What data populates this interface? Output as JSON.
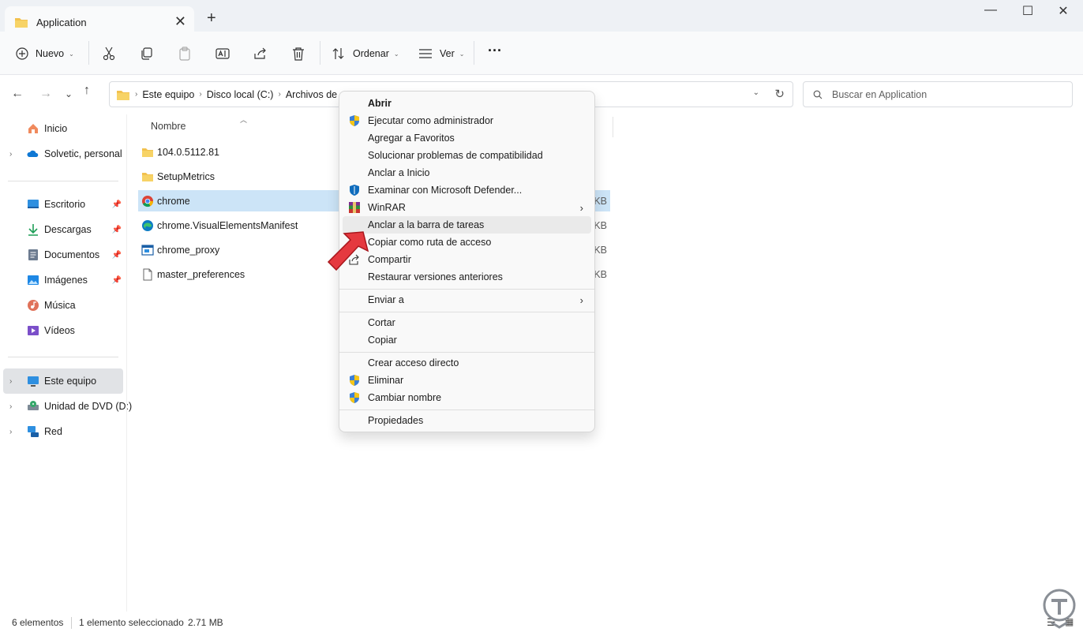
{
  "window": {
    "tab_title": "Application",
    "close_tab": "✕",
    "new_tab": "+",
    "minimize": "—",
    "maximize": "☐",
    "close": "✕"
  },
  "toolbar": {
    "new_label": "Nuevo",
    "sort_label": "Ordenar",
    "view_label": "Ver",
    "more_label": "···"
  },
  "address": {
    "crumbs": [
      "Este equipo",
      "Disco local (C:)",
      "Archivos de"
    ]
  },
  "search": {
    "placeholder": "Buscar en Application"
  },
  "sidebar": {
    "items": [
      {
        "label": "Inicio",
        "icon": "home-icon"
      },
      {
        "label": "Solvetic, personal",
        "icon": "cloud-icon"
      },
      {
        "label": "Escritorio",
        "icon": "desktop-icon"
      },
      {
        "label": "Descargas",
        "icon": "download-icon"
      },
      {
        "label": "Documentos",
        "icon": "documents-icon"
      },
      {
        "label": "Imágenes",
        "icon": "pictures-icon"
      },
      {
        "label": "Música",
        "icon": "music-icon"
      },
      {
        "label": "Vídeos",
        "icon": "videos-icon"
      },
      {
        "label": "Este equipo",
        "icon": "computer-icon"
      },
      {
        "label": "Unidad de DVD (D:)",
        "icon": "dvd-icon"
      },
      {
        "label": "Red",
        "icon": "network-icon"
      }
    ]
  },
  "files": {
    "column_name": "Nombre",
    "rows": [
      {
        "name": "104.0.5112.81",
        "size": "",
        "icon": "folder-icon"
      },
      {
        "name": "SetupMetrics",
        "size": "",
        "icon": "folder-icon"
      },
      {
        "name": "chrome",
        "size": "KB",
        "icon": "chrome-icon"
      },
      {
        "name": "chrome.VisualElementsManifest",
        "size": "KB",
        "icon": "edge-icon"
      },
      {
        "name": "chrome_proxy",
        "size": "KB",
        "icon": "app-icon"
      },
      {
        "name": "master_preferences",
        "size": "KB",
        "icon": "file-icon"
      }
    ]
  },
  "context_menu": {
    "items": [
      {
        "label": "Abrir",
        "bold": true
      },
      {
        "label": "Ejecutar como administrador",
        "icon": "uac-shield-icon"
      },
      {
        "label": "Agregar a Favoritos"
      },
      {
        "label": "Solucionar problemas de compatibilidad"
      },
      {
        "label": "Anclar a Inicio"
      },
      {
        "label": "Examinar con Microsoft Defender...",
        "icon": "defender-icon"
      },
      {
        "label": "WinRAR",
        "icon": "winrar-icon",
        "submenu": true
      },
      {
        "label": "Anclar a la barra de tareas",
        "highlighted": true
      },
      {
        "label": "Copiar como ruta de acceso"
      },
      {
        "label": "Compartir",
        "icon": "share-icon"
      },
      {
        "label": "Restaurar versiones anteriores"
      },
      {
        "label": "Enviar a",
        "submenu": true
      },
      {
        "label": "Cortar"
      },
      {
        "label": "Copiar"
      },
      {
        "label": "Crear acceso directo"
      },
      {
        "label": "Eliminar",
        "icon": "uac-shield-icon"
      },
      {
        "label": "Cambiar nombre",
        "icon": "uac-shield-icon"
      },
      {
        "label": "Propiedades"
      }
    ],
    "submenu_arrow": "›"
  },
  "status": {
    "count": "6 elementos",
    "selection": "1 elemento seleccionado",
    "size": "2.71 MB"
  },
  "colors": {
    "selection": "#cce4f7",
    "folder": "#f2c14e",
    "accent": "#0067c0",
    "arrow": "#e5393f"
  }
}
